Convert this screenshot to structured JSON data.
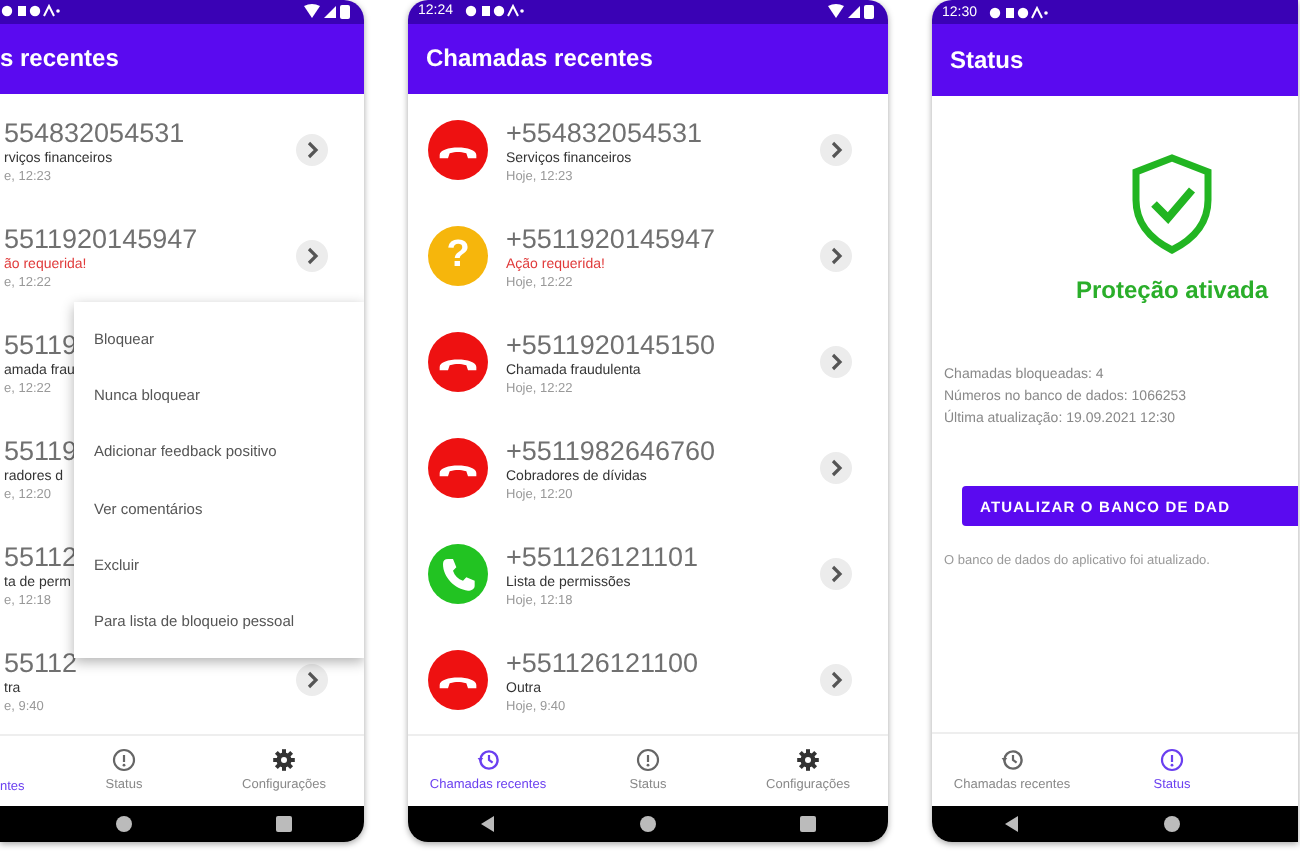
{
  "phones": [
    {
      "kind": "calls",
      "title": "s recentes",
      "rows": [
        {
          "kind": "none",
          "number": "554832054531",
          "label": "rviços financeiros",
          "alert": false,
          "time": "e, 12:23"
        },
        {
          "kind": "none",
          "number": "5511920145947",
          "label": "ão requerida!",
          "alert": true,
          "time": "e, 12:22"
        },
        {
          "kind": "none",
          "number": "55119",
          "label": "amada frau",
          "alert": false,
          "time": "e, 12:22"
        },
        {
          "kind": "none",
          "number": "55119",
          "label": "radores d",
          "alert": false,
          "time": "e, 12:20"
        },
        {
          "kind": "none",
          "number": "55112",
          "label": "ta de perm",
          "alert": false,
          "time": "e, 12:18"
        },
        {
          "kind": "none",
          "number": "55112",
          "label": "tra",
          "alert": false,
          "time": "e, 9:40"
        }
      ],
      "menu": [
        "Bloquear",
        "Nunca bloquear",
        "Adicionar feedback positivo",
        "Ver comentários",
        "Excluir",
        "Para lista de bloqueio pessoal"
      ],
      "nav": [
        {
          "label": "ntes",
          "selected": true
        },
        {
          "label": "Status",
          "selected": false
        },
        {
          "label": "Configurações",
          "selected": false
        }
      ]
    },
    {
      "kind": "calls",
      "status_time": "12:24",
      "title": "Chamadas recentes",
      "rows": [
        {
          "kind": "blocked",
          "number": "+554832054531",
          "label": "Serviços financeiros",
          "alert": false,
          "time": "Hoje, 12:23"
        },
        {
          "kind": "unknown",
          "symbol": "?",
          "number": "+5511920145947",
          "label": "Ação requerida!",
          "alert": true,
          "time": "Hoje, 12:22"
        },
        {
          "kind": "blocked",
          "number": "+5511920145150",
          "label": "Chamada fraudulenta",
          "alert": false,
          "time": "Hoje, 12:22"
        },
        {
          "kind": "blocked",
          "number": "+5511982646760",
          "label": "Cobradores de dívidas",
          "alert": false,
          "time": "Hoje, 12:20"
        },
        {
          "kind": "allowed",
          "number": "+551126121101",
          "label": "Lista de permissões",
          "alert": false,
          "time": "Hoje, 12:18"
        },
        {
          "kind": "blocked",
          "number": "+551126121100",
          "label": "Outra",
          "alert": false,
          "time": "Hoje, 9:40"
        }
      ],
      "nav": [
        {
          "label": "Chamadas recentes",
          "selected": true
        },
        {
          "label": "Status",
          "selected": false
        },
        {
          "label": "Configurações",
          "selected": false
        }
      ]
    },
    {
      "kind": "status",
      "status_time": "12:30",
      "title": "Status",
      "status_text": "Proteção ativada",
      "stats": [
        "Chamadas bloqueadas: 4",
        "Números no banco de dados: 1066253",
        "Última atualização: 19.09.2021 12:30"
      ],
      "button": "ATUALIZAR O BANCO DE DAD",
      "note": "O banco de dados do aplicativo foi atualizado.",
      "nav": [
        {
          "label": "Chamadas recentes",
          "selected": false
        },
        {
          "label": "Status",
          "selected": true
        }
      ]
    }
  ]
}
